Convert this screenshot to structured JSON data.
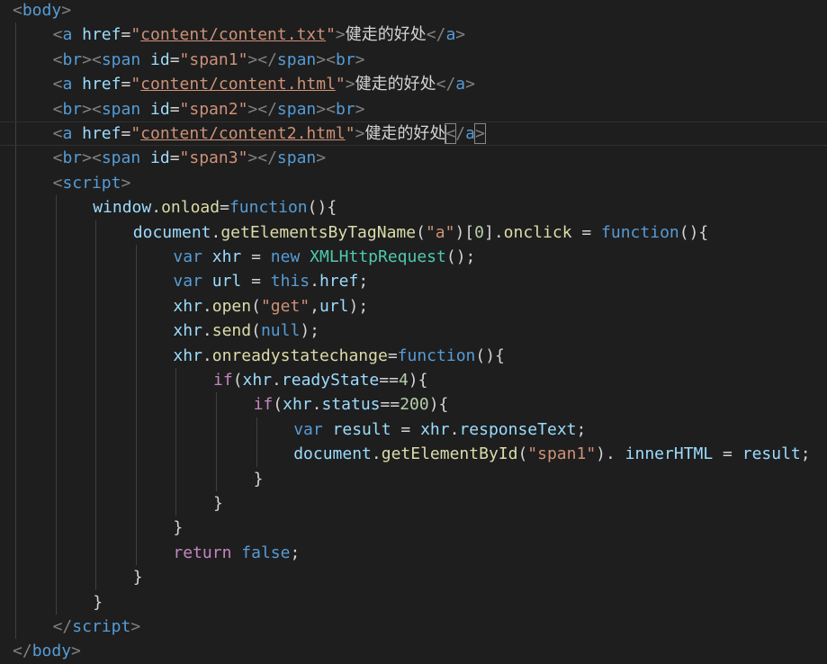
{
  "editor": {
    "language": "html",
    "current_line": 6,
    "colors": {
      "background": "#1e1e1e",
      "tag_punctuation": "#808080",
      "tag_name": "#569cd6",
      "attribute": "#9cdcfe",
      "string": "#ce9178",
      "function": "#dcdcaa",
      "keyword": "#569cd6",
      "control_keyword": "#c586c0",
      "number": "#b5cea8",
      "class": "#4ec9b0",
      "text": "#d4d4d4"
    },
    "lines": [
      {
        "indent": 0,
        "tokens": [
          [
            "punct",
            "<"
          ],
          [
            "tag",
            "body"
          ],
          [
            "punct",
            ">"
          ]
        ]
      },
      {
        "indent": 1,
        "tokens": [
          [
            "punct",
            "<"
          ],
          [
            "tag",
            "a"
          ],
          [
            "op",
            " "
          ],
          [
            "attr",
            "href"
          ],
          [
            "op",
            "="
          ],
          [
            "str",
            "\""
          ],
          [
            "strlink",
            "content/content.txt"
          ],
          [
            "str",
            "\""
          ],
          [
            "punct",
            ">"
          ],
          [
            "text",
            "健走的好处"
          ],
          [
            "punct",
            "</"
          ],
          [
            "tag",
            "a"
          ],
          [
            "punct",
            ">"
          ]
        ]
      },
      {
        "indent": 1,
        "tokens": [
          [
            "punct",
            "<"
          ],
          [
            "tag",
            "br"
          ],
          [
            "punct",
            "><"
          ],
          [
            "tag",
            "span"
          ],
          [
            "op",
            " "
          ],
          [
            "attr",
            "id"
          ],
          [
            "op",
            "="
          ],
          [
            "str",
            "\"span1\""
          ],
          [
            "punct",
            "></"
          ],
          [
            "tag",
            "span"
          ],
          [
            "punct",
            "><"
          ],
          [
            "tag",
            "br"
          ],
          [
            "punct",
            ">"
          ]
        ]
      },
      {
        "indent": 1,
        "tokens": [
          [
            "punct",
            "<"
          ],
          [
            "tag",
            "a"
          ],
          [
            "op",
            " "
          ],
          [
            "attr",
            "href"
          ],
          [
            "op",
            "="
          ],
          [
            "str",
            "\""
          ],
          [
            "strlink",
            "content/content.html"
          ],
          [
            "str",
            "\""
          ],
          [
            "punct",
            ">"
          ],
          [
            "text",
            "健走的好处"
          ],
          [
            "punct",
            "</"
          ],
          [
            "tag",
            "a"
          ],
          [
            "punct",
            ">"
          ]
        ]
      },
      {
        "indent": 1,
        "tokens": [
          [
            "punct",
            "<"
          ],
          [
            "tag",
            "br"
          ],
          [
            "punct",
            "><"
          ],
          [
            "tag",
            "span"
          ],
          [
            "op",
            " "
          ],
          [
            "attr",
            "id"
          ],
          [
            "op",
            "="
          ],
          [
            "str",
            "\"span2\""
          ],
          [
            "punct",
            "></"
          ],
          [
            "tag",
            "span"
          ],
          [
            "punct",
            "><"
          ],
          [
            "tag",
            "br"
          ],
          [
            "punct",
            ">"
          ]
        ]
      },
      {
        "indent": 1,
        "tokens": [
          [
            "punct",
            "<"
          ],
          [
            "tag",
            "a"
          ],
          [
            "op",
            " "
          ],
          [
            "attr",
            "href"
          ],
          [
            "op",
            "="
          ],
          [
            "str",
            "\""
          ],
          [
            "strlink",
            "content/content2.html"
          ],
          [
            "str",
            "\""
          ],
          [
            "punct",
            ">"
          ],
          [
            "text",
            "健走的好处"
          ],
          [
            "cursor",
            ""
          ],
          [
            "punct_hl",
            "<"
          ],
          [
            "punct",
            "/"
          ],
          [
            "tag",
            "a"
          ],
          [
            "punct_hl",
            ">"
          ]
        ]
      },
      {
        "indent": 1,
        "tokens": [
          [
            "punct",
            "<"
          ],
          [
            "tag",
            "br"
          ],
          [
            "punct",
            "><"
          ],
          [
            "tag",
            "span"
          ],
          [
            "op",
            " "
          ],
          [
            "attr",
            "id"
          ],
          [
            "op",
            "="
          ],
          [
            "str",
            "\"span3\""
          ],
          [
            "punct",
            "></"
          ],
          [
            "tag",
            "span"
          ],
          [
            "punct",
            ">"
          ]
        ]
      },
      {
        "indent": 1,
        "tokens": [
          [
            "punct",
            "<"
          ],
          [
            "tag",
            "script"
          ],
          [
            "punct",
            ">"
          ]
        ]
      },
      {
        "indent": 2,
        "tokens": [
          [
            "var",
            "window"
          ],
          [
            "op",
            "."
          ],
          [
            "fn",
            "onload"
          ],
          [
            "op",
            "="
          ],
          [
            "kw",
            "function"
          ],
          [
            "op",
            "(){"
          ]
        ]
      },
      {
        "indent": 3,
        "tokens": [
          [
            "var",
            "document"
          ],
          [
            "op",
            "."
          ],
          [
            "fn",
            "getElementsByTagName"
          ],
          [
            "op",
            "("
          ],
          [
            "str",
            "\"a\""
          ],
          [
            "op",
            ")["
          ],
          [
            "num",
            "0"
          ],
          [
            "op",
            "]."
          ],
          [
            "fn",
            "onclick"
          ],
          [
            "op",
            " = "
          ],
          [
            "kw",
            "function"
          ],
          [
            "op",
            "(){"
          ]
        ]
      },
      {
        "indent": 4,
        "tokens": [
          [
            "kw",
            "var"
          ],
          [
            "op",
            " "
          ],
          [
            "var",
            "xhr"
          ],
          [
            "op",
            " = "
          ],
          [
            "kw",
            "new"
          ],
          [
            "op",
            " "
          ],
          [
            "class",
            "XMLHttpRequest"
          ],
          [
            "op",
            "();"
          ]
        ]
      },
      {
        "indent": 4,
        "tokens": [
          [
            "kw",
            "var"
          ],
          [
            "op",
            " "
          ],
          [
            "var",
            "url"
          ],
          [
            "op",
            " = "
          ],
          [
            "kw",
            "this"
          ],
          [
            "op",
            "."
          ],
          [
            "prop",
            "href"
          ],
          [
            "op",
            ";"
          ]
        ]
      },
      {
        "indent": 4,
        "tokens": [
          [
            "var",
            "xhr"
          ],
          [
            "op",
            "."
          ],
          [
            "fn",
            "open"
          ],
          [
            "op",
            "("
          ],
          [
            "str",
            "\"get\""
          ],
          [
            "op",
            ","
          ],
          [
            "var",
            "url"
          ],
          [
            "op",
            ");"
          ]
        ]
      },
      {
        "indent": 4,
        "tokens": [
          [
            "var",
            "xhr"
          ],
          [
            "op",
            "."
          ],
          [
            "fn",
            "send"
          ],
          [
            "op",
            "("
          ],
          [
            "kw",
            "null"
          ],
          [
            "op",
            ");"
          ]
        ]
      },
      {
        "indent": 4,
        "tokens": [
          [
            "var",
            "xhr"
          ],
          [
            "op",
            "."
          ],
          [
            "fn",
            "onreadystatechange"
          ],
          [
            "op",
            "="
          ],
          [
            "kw",
            "function"
          ],
          [
            "op",
            "(){"
          ]
        ]
      },
      {
        "indent": 5,
        "tokens": [
          [
            "ctrl",
            "if"
          ],
          [
            "op",
            "("
          ],
          [
            "var",
            "xhr"
          ],
          [
            "op",
            "."
          ],
          [
            "prop",
            "readyState"
          ],
          [
            "op",
            "=="
          ],
          [
            "num",
            "4"
          ],
          [
            "op",
            "){"
          ]
        ]
      },
      {
        "indent": 6,
        "tokens": [
          [
            "ctrl",
            "if"
          ],
          [
            "op",
            "("
          ],
          [
            "var",
            "xhr"
          ],
          [
            "op",
            "."
          ],
          [
            "prop",
            "status"
          ],
          [
            "op",
            "=="
          ],
          [
            "num",
            "200"
          ],
          [
            "op",
            "){"
          ]
        ]
      },
      {
        "indent": 7,
        "tokens": [
          [
            "kw",
            "var"
          ],
          [
            "op",
            " "
          ],
          [
            "var",
            "result"
          ],
          [
            "op",
            " = "
          ],
          [
            "var",
            "xhr"
          ],
          [
            "op",
            "."
          ],
          [
            "prop",
            "responseText"
          ],
          [
            "op",
            ";"
          ]
        ]
      },
      {
        "indent": 7,
        "tokens": [
          [
            "var",
            "document"
          ],
          [
            "op",
            "."
          ],
          [
            "fn",
            "getElementById"
          ],
          [
            "op",
            "("
          ],
          [
            "str",
            "\"span1\""
          ],
          [
            "op",
            "). "
          ],
          [
            "prop",
            "innerHTML"
          ],
          [
            "op",
            " = "
          ],
          [
            "var",
            "result"
          ],
          [
            "op",
            ";"
          ]
        ]
      },
      {
        "indent": 6,
        "tokens": [
          [
            "op",
            "}"
          ]
        ]
      },
      {
        "indent": 5,
        "tokens": [
          [
            "op",
            "}"
          ]
        ]
      },
      {
        "indent": 4,
        "tokens": [
          [
            "op",
            "}"
          ]
        ]
      },
      {
        "indent": 4,
        "tokens": [
          [
            "ctrl",
            "return"
          ],
          [
            "op",
            " "
          ],
          [
            "kw",
            "false"
          ],
          [
            "op",
            ";"
          ]
        ]
      },
      {
        "indent": 3,
        "tokens": [
          [
            "op",
            "}"
          ]
        ]
      },
      {
        "indent": 2,
        "tokens": [
          [
            "op",
            "}"
          ]
        ]
      },
      {
        "indent": 1,
        "tokens": [
          [
            "punct",
            "</"
          ],
          [
            "tag",
            "script"
          ],
          [
            "punct",
            ">"
          ]
        ]
      },
      {
        "indent": 0,
        "tokens": [
          [
            "punct",
            "</"
          ],
          [
            "tag",
            "body"
          ],
          [
            "punct",
            ">"
          ]
        ]
      }
    ]
  }
}
